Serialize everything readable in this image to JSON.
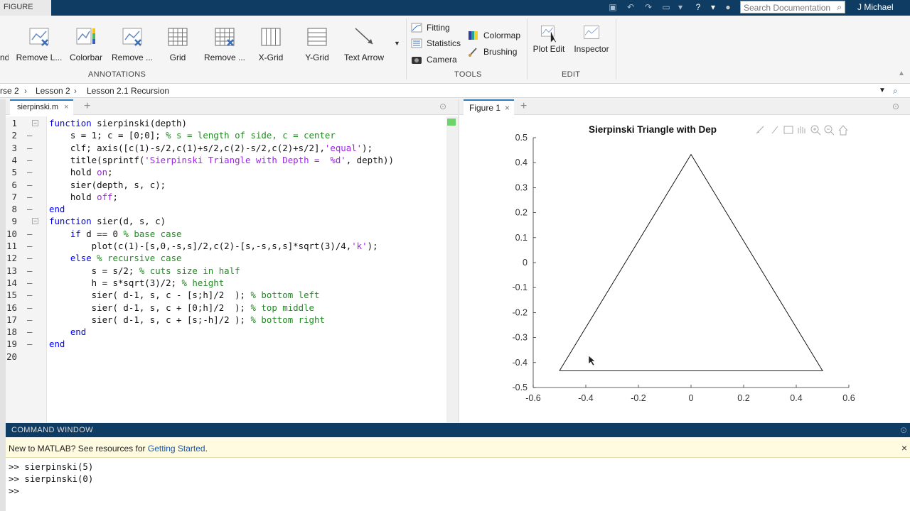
{
  "titlebar": {
    "tab_label": "FIGURE",
    "search_placeholder": "Search Documentation",
    "user": "J Michael"
  },
  "toolstrip": {
    "annotations": {
      "label": "ANNOTATIONS",
      "buttons": [
        "nd",
        "Remove L...",
        "Colorbar",
        "Remove ...",
        "Grid",
        "Remove ...",
        "X-Grid",
        "Y-Grid",
        "Text Arrow"
      ]
    },
    "tools": {
      "label": "TOOLS",
      "items": [
        "Fitting",
        "Statistics",
        "Camera",
        "Colormap",
        "Brushing"
      ]
    },
    "edit": {
      "label": "EDIT",
      "buttons": [
        "Plot Edit",
        "Inspector"
      ]
    }
  },
  "address": {
    "crumbs": [
      "rse 2",
      "Lesson 2",
      "Lesson 2.1 Recursion"
    ]
  },
  "editor": {
    "tab": "sierpinski.m",
    "lines": [
      {
        "n": "1",
        "dash": "",
        "fold": "⊟",
        "html": "<span class='kw'>function</span> sierpinski(depth)"
      },
      {
        "n": "2",
        "dash": "–",
        "fold": "",
        "html": "    s = 1; c = [0;0]; <span class='cm'>% s = length of side, c = center</span>"
      },
      {
        "n": "3",
        "dash": "–",
        "fold": "",
        "html": "    clf; axis([c(1)-s/2,c(1)+s/2,c(2)-s/2,c(2)+s/2],<span class='str'>'equal'</span>);"
      },
      {
        "n": "4",
        "dash": "–",
        "fold": "",
        "html": "    title(sprintf(<span class='str'>'Sierpinski Triangle with Depth =  %d'</span>, depth))"
      },
      {
        "n": "5",
        "dash": "–",
        "fold": "",
        "html": "    hold <span class='str'>on</span>;"
      },
      {
        "n": "6",
        "dash": "–",
        "fold": "",
        "html": "    sier(depth, s, c);"
      },
      {
        "n": "7",
        "dash": "–",
        "fold": "",
        "html": "    hold <span class='str'>off</span>;"
      },
      {
        "n": "8",
        "dash": "–",
        "fold": "",
        "html": "<span class='kw'>end</span>"
      },
      {
        "n": "9",
        "dash": "",
        "fold": "⊟",
        "html": "<span class='kw'>function</span> sier(d, s, c)"
      },
      {
        "n": "10",
        "dash": "–",
        "fold": "",
        "html": "    <span class='kw'>if</span> d == 0 <span class='cm'>% base case</span>"
      },
      {
        "n": "11",
        "dash": "–",
        "fold": "",
        "html": "        plot(c(1)-[s,0,-s,s]/2,c(2)-[s,-s,s,s]*sqrt(3)/4,<span class='str'>'k'</span>);"
      },
      {
        "n": "12",
        "dash": "–",
        "fold": "",
        "html": "    <span class='kw'>else</span> <span class='cm'>% recursive case</span>"
      },
      {
        "n": "13",
        "dash": "–",
        "fold": "",
        "html": "        s = s/2; <span class='cm'>% cuts size in half</span>"
      },
      {
        "n": "14",
        "dash": "–",
        "fold": "",
        "html": "        h = s*sqrt(3)/2; <span class='cm'>% height</span>"
      },
      {
        "n": "15",
        "dash": "–",
        "fold": "",
        "html": "        sier( d-1, s, c - [s;h]/2  ); <span class='cm'>% bottom left</span>"
      },
      {
        "n": "16",
        "dash": "–",
        "fold": "",
        "html": "        sier( d-1, s, c + [0;h]/2  ); <span class='cm'>% top middle</span>"
      },
      {
        "n": "17",
        "dash": "–",
        "fold": "",
        "html": "        sier( d-1, s, c + [s;-h]/2 ); <span class='cm'>% bottom right</span>"
      },
      {
        "n": "18",
        "dash": "–",
        "fold": "",
        "html": "    <span class='kw'>end</span>"
      },
      {
        "n": "19",
        "dash": "–",
        "fold": "",
        "html": "<span class='kw'>end</span>"
      },
      {
        "n": "20",
        "dash": "",
        "fold": "",
        "html": ""
      }
    ]
  },
  "figure": {
    "tab": "Figure 1",
    "title": "Sierpinski Triangle with Dep",
    "xticks": [
      "-0.6",
      "-0.4",
      "-0.2",
      "0",
      "0.2",
      "0.4",
      "0.6"
    ],
    "yticks": [
      "0.5",
      "0.4",
      "0.3",
      "0.2",
      "0.1",
      "0",
      "-0.1",
      "-0.2",
      "-0.3",
      "-0.4",
      "-0.5"
    ]
  },
  "chart_data": {
    "type": "line",
    "title": "Sierpinski Triangle with Dep",
    "xlim": [
      -0.6,
      0.6
    ],
    "ylim": [
      -0.5,
      0.5
    ],
    "series": [
      {
        "x": [
          -0.5,
          0,
          0.5,
          -0.5
        ],
        "y": [
          -0.433,
          0.433,
          -0.433,
          -0.433
        ]
      }
    ],
    "color": "#000000"
  },
  "command": {
    "title": "COMMAND WINDOW",
    "notice_text": "New to MATLAB? See resources for ",
    "notice_link": "Getting Started",
    "notice_end": ".",
    "lines": [
      ">> sierpinski(5)",
      ">> sierpinski(0)",
      ">> "
    ]
  }
}
